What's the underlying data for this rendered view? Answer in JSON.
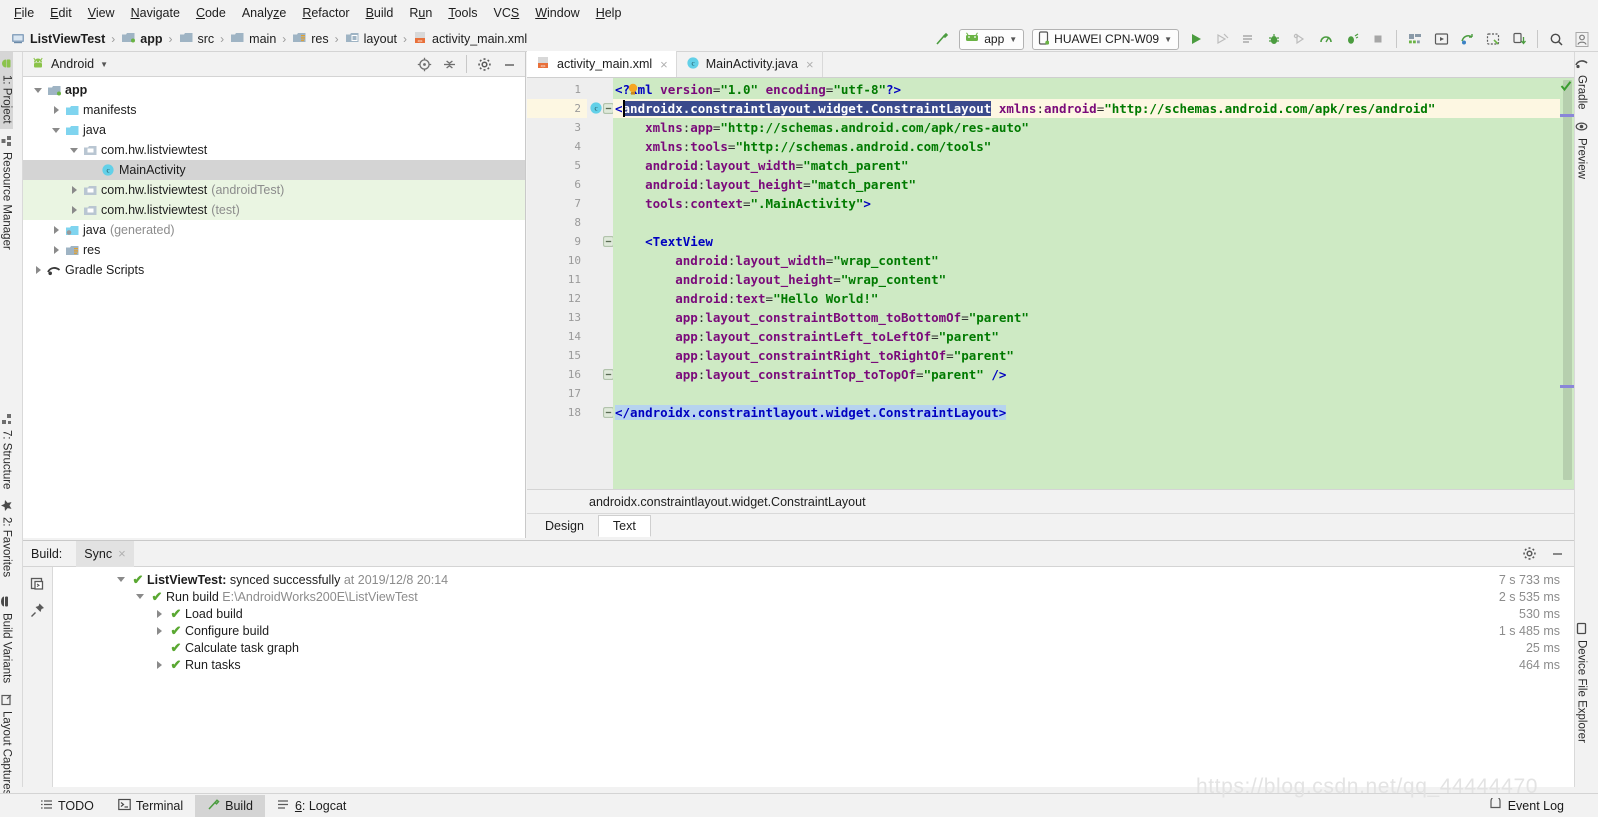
{
  "menu": {
    "items": [
      {
        "label": "File",
        "mnemonic": "F"
      },
      {
        "label": "Edit",
        "mnemonic": "E"
      },
      {
        "label": "View",
        "mnemonic": "V"
      },
      {
        "label": "Navigate",
        "mnemonic": "N"
      },
      {
        "label": "Code",
        "mnemonic": "C"
      },
      {
        "label": "Analyze",
        "mnemonic": "z"
      },
      {
        "label": "Refactor",
        "mnemonic": "R"
      },
      {
        "label": "Build",
        "mnemonic": "B"
      },
      {
        "label": "Run",
        "mnemonic": "u"
      },
      {
        "label": "Tools",
        "mnemonic": "T"
      },
      {
        "label": "VCS",
        "mnemonic": "S"
      },
      {
        "label": "Window",
        "mnemonic": "W"
      },
      {
        "label": "Help",
        "mnemonic": "H"
      }
    ]
  },
  "breadcrumb": {
    "items": [
      {
        "label": "ListViewTest",
        "icon": "project-icon",
        "bold": true
      },
      {
        "label": "app",
        "icon": "module-icon",
        "bold": true
      },
      {
        "label": "src",
        "icon": "folder-icon",
        "bold": false
      },
      {
        "label": "main",
        "icon": "folder-icon",
        "bold": false
      },
      {
        "label": "res",
        "icon": "res-folder-icon",
        "bold": false
      },
      {
        "label": "layout",
        "icon": "layout-folder-icon",
        "bold": false
      },
      {
        "label": "activity_main.xml",
        "icon": "xml-file-icon",
        "bold": false
      }
    ],
    "separator": "›"
  },
  "toolbar": {
    "build_hammer": "build-icon",
    "run_config": {
      "label": "app",
      "icon": "android-icon",
      "caret": "▼"
    },
    "device": {
      "label": "HUAWEI CPN-W09",
      "icon": "device-icon",
      "caret": "▼"
    },
    "buttons": [
      {
        "name": "run-button",
        "icon": "play",
        "enabled": true
      },
      {
        "name": "apply-changes-button",
        "icon": "apply-changes",
        "enabled": false
      },
      {
        "name": "apply-code-changes-button",
        "icon": "apply-code",
        "enabled": false
      },
      {
        "name": "debug-button",
        "icon": "debug",
        "enabled": true
      },
      {
        "name": "attach-debugger-button",
        "icon": "attach-debug",
        "enabled": false
      },
      {
        "name": "profile-button",
        "icon": "profiler",
        "enabled": true
      },
      {
        "name": "run-coverage-button",
        "icon": "coverage",
        "enabled": true
      },
      {
        "name": "stop-button",
        "icon": "stop",
        "enabled": false
      }
    ],
    "buttons2": [
      {
        "name": "sdk-manager-button",
        "icon": "sdk-manager"
      },
      {
        "name": "avd-manager-button",
        "icon": "avd-manager"
      },
      {
        "name": "gradle-sync-button",
        "icon": "gradle-sync"
      },
      {
        "name": "layout-inspector-button",
        "icon": "layout-inspector"
      },
      {
        "name": "device-manager-button",
        "icon": "device-download"
      }
    ],
    "buttons3": [
      {
        "name": "search-everywhere-button",
        "icon": "search"
      },
      {
        "name": "account-button",
        "icon": "avatar"
      }
    ]
  },
  "left_strip": {
    "top": [
      {
        "label": "1: Project",
        "icon": "project-icon",
        "selected": true
      },
      {
        "label": "Resource Manager",
        "icon": "resource-manager-icon",
        "selected": false
      }
    ],
    "middle": [
      {
        "label": "7: Structure",
        "icon": "structure-icon",
        "selected": false
      },
      {
        "label": "2: Favorites",
        "icon": "star-icon",
        "selected": false
      }
    ],
    "bottom": [
      {
        "label": "Build Variants",
        "icon": "build-variants-icon",
        "selected": false
      },
      {
        "label": "Layout Captures",
        "icon": "layout-captures-icon",
        "selected": false
      }
    ]
  },
  "right_strip": {
    "top": [
      {
        "label": "Gradle",
        "icon": "gradle-icon"
      },
      {
        "label": "Preview",
        "icon": "preview-eye-icon"
      }
    ],
    "bottom": [
      {
        "label": "Device File Explorer",
        "icon": "device-file-explorer-icon"
      }
    ]
  },
  "project_panel": {
    "title": "Android",
    "title_icon": "android-head-icon",
    "caret": "▼",
    "tools": [
      {
        "name": "scroll-from-source-button",
        "icon": "target-icon"
      },
      {
        "name": "collapse-all-button",
        "icon": "collapse-icon"
      },
      {
        "name": "settings-button",
        "icon": "gear-icon"
      },
      {
        "name": "hide-button",
        "icon": "minimize-icon"
      }
    ],
    "tree": [
      {
        "label": "app",
        "sub": "",
        "indent": 0,
        "arrow": "down",
        "icon": "module-icon",
        "bold": true,
        "selected": false,
        "green": false
      },
      {
        "label": "manifests",
        "sub": "",
        "indent": 1,
        "arrow": "right",
        "icon": "folder-blue-icon",
        "bold": false,
        "selected": false,
        "green": false
      },
      {
        "label": "java",
        "sub": "",
        "indent": 1,
        "arrow": "down",
        "icon": "folder-blue-icon",
        "bold": false,
        "selected": false,
        "green": false
      },
      {
        "label": "com.hw.listviewtest",
        "sub": "",
        "indent": 2,
        "arrow": "down",
        "icon": "package-icon",
        "bold": false,
        "selected": false,
        "green": false
      },
      {
        "label": "MainActivity",
        "sub": "",
        "indent": 3,
        "arrow": "none",
        "icon": "class-icon",
        "bold": false,
        "selected": true,
        "green": false
      },
      {
        "label": "com.hw.listviewtest",
        "sub": "(androidTest)",
        "indent": 2,
        "arrow": "right",
        "icon": "package-icon",
        "bold": false,
        "selected": false,
        "green": true
      },
      {
        "label": "com.hw.listviewtest",
        "sub": "(test)",
        "indent": 2,
        "arrow": "right",
        "icon": "package-icon",
        "bold": false,
        "selected": false,
        "green": true
      },
      {
        "label": "java",
        "sub": "(generated)",
        "indent": 1,
        "arrow": "right",
        "icon": "folder-generated-icon",
        "bold": false,
        "selected": false,
        "green": false
      },
      {
        "label": "res",
        "sub": "",
        "indent": 1,
        "arrow": "right",
        "icon": "res-folder-icon",
        "bold": false,
        "selected": false,
        "green": false
      },
      {
        "label": "Gradle Scripts",
        "sub": "",
        "indent": 0,
        "arrow": "right",
        "icon": "gradle-icon",
        "bold": false,
        "selected": false,
        "green": false
      }
    ]
  },
  "editor": {
    "tabs": [
      {
        "label": "activity_main.xml",
        "icon": "xml-file-icon",
        "active": true,
        "close": "×"
      },
      {
        "label": "MainActivity.java",
        "icon": "class-icon",
        "active": false,
        "close": "×"
      }
    ],
    "status_breadcrumb": "androidx.constraintlayout.widget.ConstraintLayout",
    "design_text_tabs": [
      {
        "label": "Design",
        "active": false
      },
      {
        "label": "Text",
        "active": true
      }
    ],
    "inspection_ok_icon": "check-icon",
    "gutter_class_icon": "C",
    "lines": [
      {
        "n": 1,
        "text": "<?xml version=\"1.0\" encoding=\"utf-8\"?>"
      },
      {
        "n": 2,
        "text": "<androidx.constraintlayout.widget.ConstraintLayout xmlns:android=\"http://schemas.android.com/apk/res/android\""
      },
      {
        "n": 3,
        "text": "    xmlns:app=\"http://schemas.android.com/apk/res-auto\""
      },
      {
        "n": 4,
        "text": "    xmlns:tools=\"http://schemas.android.com/tools\""
      },
      {
        "n": 5,
        "text": "    android:layout_width=\"match_parent\""
      },
      {
        "n": 6,
        "text": "    android:layout_height=\"match_parent\""
      },
      {
        "n": 7,
        "text": "    tools:context=\".MainActivity\">"
      },
      {
        "n": 8,
        "text": ""
      },
      {
        "n": 9,
        "text": "    <TextView"
      },
      {
        "n": 10,
        "text": "        android:layout_width=\"wrap_content\""
      },
      {
        "n": 11,
        "text": "        android:layout_height=\"wrap_content\""
      },
      {
        "n": 12,
        "text": "        android:text=\"Hello World!\""
      },
      {
        "n": 13,
        "text": "        app:layout_constraintBottom_toBottomOf=\"parent\""
      },
      {
        "n": 14,
        "text": "        app:layout_constraintLeft_toLeftOf=\"parent\""
      },
      {
        "n": 15,
        "text": "        app:layout_constraintRight_toRightOf=\"parent\""
      },
      {
        "n": 16,
        "text": "        app:layout_constraintTop_toTopOf=\"parent\" />"
      },
      {
        "n": 17,
        "text": ""
      },
      {
        "n": 18,
        "text": "</androidx.constraintlayout.widget.ConstraintLayout>"
      }
    ]
  },
  "build_panel": {
    "label": "Build:",
    "tab": {
      "label": "Sync",
      "close": "×"
    },
    "tools": [
      {
        "name": "build-settings-button",
        "icon": "gear-icon"
      },
      {
        "name": "build-hide-button",
        "icon": "minimize-icon"
      }
    ],
    "side_buttons": [
      {
        "name": "toggle-view-button",
        "icon": "console-icon"
      },
      {
        "name": "pin-tab-button",
        "icon": "pin-icon"
      }
    ],
    "rows": [
      {
        "text": "ListViewTest:",
        "text2": "synced successfully",
        "muted": "at 2019/12/8 20:14",
        "indent": 0,
        "arrow": "down",
        "time": "7 s 733 ms",
        "bold": true
      },
      {
        "text": "",
        "text2": "Run build",
        "muted": "E:\\AndroidWorks200E\\ListViewTest",
        "indent": 1,
        "arrow": "down",
        "time": "2 s 535 ms",
        "bold": false
      },
      {
        "text": "",
        "text2": "Load build",
        "muted": "",
        "indent": 2,
        "arrow": "right",
        "time": "530 ms",
        "bold": false
      },
      {
        "text": "",
        "text2": "Configure build",
        "muted": "",
        "indent": 2,
        "arrow": "right",
        "time": "1 s 485 ms",
        "bold": false
      },
      {
        "text": "",
        "text2": "Calculate task graph",
        "muted": "",
        "indent": 2,
        "arrow": "none",
        "time": "25 ms",
        "bold": false
      },
      {
        "text": "",
        "text2": "Run tasks",
        "muted": "",
        "indent": 2,
        "arrow": "right",
        "time": "464 ms",
        "bold": false
      }
    ]
  },
  "statusbar": {
    "items": [
      {
        "label": "TODO",
        "icon": "todo-icon",
        "selected": false
      },
      {
        "label": "Terminal",
        "icon": "terminal-icon",
        "selected": false
      },
      {
        "label": "Build",
        "icon": "build-hammer-icon",
        "selected": true
      },
      {
        "label": "6: Logcat",
        "icon": "logcat-icon",
        "selected": false
      }
    ],
    "event_log": {
      "label": "Event Log",
      "icon": "event-log-icon"
    }
  },
  "watermark": "https://blog.csdn.net/qq_44444470",
  "colors": {
    "accent_green": "#4b9c3f",
    "editor_bg": "#ceeac4",
    "selection_blue": "#3a4a8c",
    "highlight_line": "#fdf7e2",
    "panel_bg": "#f2f2f2",
    "tree_green": "#eaf5e2"
  }
}
